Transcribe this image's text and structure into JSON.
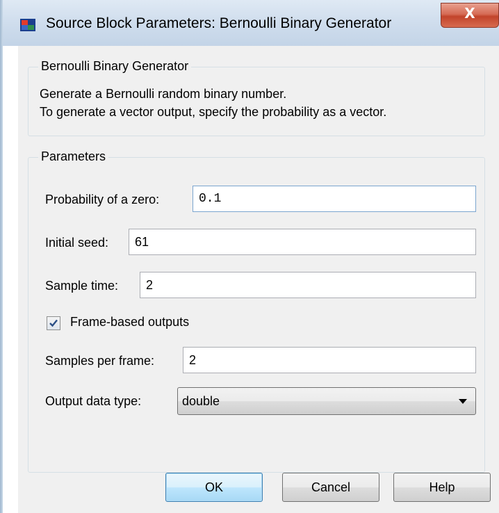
{
  "window": {
    "title": "Source Block Parameters: Bernoulli Binary Generator",
    "close_glyph": "X",
    "app_icon": "simulink-icon",
    "close_color": "#c7442b"
  },
  "description": {
    "legend": "Bernoulli Binary Generator",
    "lines": [
      "Generate a Bernoulli random binary number.",
      "To generate a vector output, specify the probability as a vector."
    ]
  },
  "parameters": {
    "legend": "Parameters",
    "probability_zero": {
      "label": "Probability of a zero:",
      "value": "0.1"
    },
    "initial_seed": {
      "label": "Initial seed:",
      "value": "61"
    },
    "sample_time": {
      "label": "Sample time:",
      "value": "2"
    },
    "frame_based": {
      "label": "Frame-based outputs",
      "checked": true
    },
    "samples_per_frame": {
      "label": "Samples per frame:",
      "value": "2"
    },
    "output_data_type": {
      "label": "Output data type:",
      "selected": "double"
    }
  },
  "buttons": {
    "ok": "OK",
    "cancel": "Cancel",
    "help": "Help"
  }
}
